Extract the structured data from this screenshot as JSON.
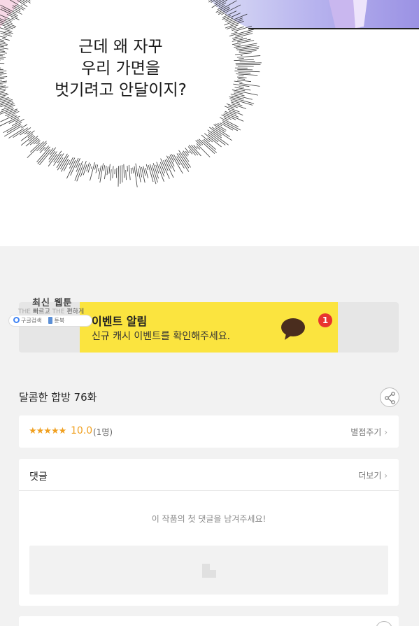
{
  "comic": {
    "speech_lines": [
      "근데 왜 자꾸",
      "우리 가면을",
      "벗기려고 안달이지?"
    ]
  },
  "watermark": {
    "title": "최신 웹툰",
    "sub_the_1": "THE",
    "sub_fast": "빠르고",
    "sub_the_2": "THE",
    "sub_easy": "편하게",
    "google_label": "구글검색",
    "site_label": "툰북"
  },
  "event_banner": {
    "title": "이벤트 알림",
    "description": "신규 캐시 이벤트를 확인해주세요.",
    "badge_count": "1",
    "accent_color": "#fbe43f"
  },
  "episode": {
    "title": "달콤한 합방 76화"
  },
  "rating": {
    "stars": "★★★★★",
    "score": "10.0",
    "count": "(1명)",
    "rate_link": "별점주기"
  },
  "comments": {
    "label": "댓글",
    "more_link": "더보기",
    "empty_message": "이 작품의 첫 댓글을 남겨주세요!"
  }
}
